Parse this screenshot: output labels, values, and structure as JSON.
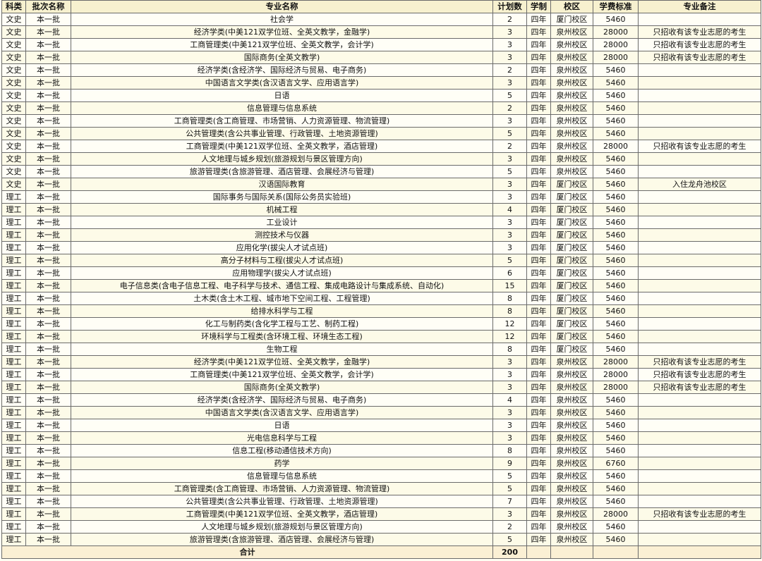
{
  "headers": {
    "category": "科类",
    "batch": "批次名称",
    "major": "专业名称",
    "plan": "计划数",
    "duration": "学制",
    "campus": "校区",
    "tuition": "学费标准",
    "remark": "专业备注"
  },
  "rows": [
    {
      "category": "文史",
      "batch": "本一批",
      "major": "社会学",
      "plan": "2",
      "duration": "四年",
      "campus": "厦门校区",
      "tuition": "5460",
      "remark": ""
    },
    {
      "category": "文史",
      "batch": "本一批",
      "major": "经济学类(中美121双学位班、全英文教学，金融学)",
      "plan": "3",
      "duration": "四年",
      "campus": "泉州校区",
      "tuition": "28000",
      "remark": "只招收有该专业志愿的考生"
    },
    {
      "category": "文史",
      "batch": "本一批",
      "major": "工商管理类(中美121双学位班、全英文教学，会计学)",
      "plan": "3",
      "duration": "四年",
      "campus": "泉州校区",
      "tuition": "28000",
      "remark": "只招收有该专业志愿的考生"
    },
    {
      "category": "文史",
      "batch": "本一批",
      "major": "国际商务(全英文教学)",
      "plan": "3",
      "duration": "四年",
      "campus": "泉州校区",
      "tuition": "28000",
      "remark": "只招收有该专业志愿的考生"
    },
    {
      "category": "文史",
      "batch": "本一批",
      "major": "经济学类(含经济学、国际经济与贸易、电子商务)",
      "plan": "2",
      "duration": "四年",
      "campus": "泉州校区",
      "tuition": "5460",
      "remark": ""
    },
    {
      "category": "文史",
      "batch": "本一批",
      "major": "中国语言文学类(含汉语言文学、应用语言学)",
      "plan": "3",
      "duration": "四年",
      "campus": "泉州校区",
      "tuition": "5460",
      "remark": ""
    },
    {
      "category": "文史",
      "batch": "本一批",
      "major": "日语",
      "plan": "5",
      "duration": "四年",
      "campus": "泉州校区",
      "tuition": "5460",
      "remark": ""
    },
    {
      "category": "文史",
      "batch": "本一批",
      "major": "信息管理与信息系统",
      "plan": "2",
      "duration": "四年",
      "campus": "泉州校区",
      "tuition": "5460",
      "remark": ""
    },
    {
      "category": "文史",
      "batch": "本一批",
      "major": "工商管理类(含工商管理、市场营销、人力资源管理、物流管理)",
      "plan": "3",
      "duration": "四年",
      "campus": "泉州校区",
      "tuition": "5460",
      "remark": ""
    },
    {
      "category": "文史",
      "batch": "本一批",
      "major": "公共管理类(含公共事业管理、行政管理、土地资源管理)",
      "plan": "5",
      "duration": "四年",
      "campus": "泉州校区",
      "tuition": "5460",
      "remark": ""
    },
    {
      "category": "文史",
      "batch": "本一批",
      "major": "工商管理类(中美121双学位班、全英文教学，酒店管理)",
      "plan": "2",
      "duration": "四年",
      "campus": "泉州校区",
      "tuition": "28000",
      "remark": "只招收有该专业志愿的考生"
    },
    {
      "category": "文史",
      "batch": "本一批",
      "major": "人文地理与城乡规划(旅游规划与景区管理方向)",
      "plan": "3",
      "duration": "四年",
      "campus": "泉州校区",
      "tuition": "5460",
      "remark": ""
    },
    {
      "category": "文史",
      "batch": "本一批",
      "major": "旅游管理类(含旅游管理、酒店管理、会展经济与管理)",
      "plan": "5",
      "duration": "四年",
      "campus": "泉州校区",
      "tuition": "5460",
      "remark": ""
    },
    {
      "category": "文史",
      "batch": "本一批",
      "major": "汉语国际教育",
      "plan": "3",
      "duration": "四年",
      "campus": "厦门校区",
      "tuition": "5460",
      "remark": "入住龙舟池校区"
    },
    {
      "category": "理工",
      "batch": "本一批",
      "major": "国际事务与国际关系(国际公务员实验班)",
      "plan": "3",
      "duration": "四年",
      "campus": "厦门校区",
      "tuition": "5460",
      "remark": ""
    },
    {
      "category": "理工",
      "batch": "本一批",
      "major": "机械工程",
      "plan": "4",
      "duration": "四年",
      "campus": "厦门校区",
      "tuition": "5460",
      "remark": ""
    },
    {
      "category": "理工",
      "batch": "本一批",
      "major": "工业设计",
      "plan": "3",
      "duration": "四年",
      "campus": "厦门校区",
      "tuition": "5460",
      "remark": ""
    },
    {
      "category": "理工",
      "batch": "本一批",
      "major": "测控技术与仪器",
      "plan": "3",
      "duration": "四年",
      "campus": "厦门校区",
      "tuition": "5460",
      "remark": ""
    },
    {
      "category": "理工",
      "batch": "本一批",
      "major": "应用化学(拔尖人才试点班)",
      "plan": "3",
      "duration": "四年",
      "campus": "厦门校区",
      "tuition": "5460",
      "remark": ""
    },
    {
      "category": "理工",
      "batch": "本一批",
      "major": "高分子材料与工程(拔尖人才试点班)",
      "plan": "5",
      "duration": "四年",
      "campus": "厦门校区",
      "tuition": "5460",
      "remark": ""
    },
    {
      "category": "理工",
      "batch": "本一批",
      "major": "应用物理学(拔尖人才试点班)",
      "plan": "6",
      "duration": "四年",
      "campus": "厦门校区",
      "tuition": "5460",
      "remark": ""
    },
    {
      "category": "理工",
      "batch": "本一批",
      "major": "电子信息类(含电子信息工程、电子科学与技术、通信工程、集成电路设计与集成系统、自动化)",
      "plan": "15",
      "duration": "四年",
      "campus": "厦门校区",
      "tuition": "5460",
      "remark": ""
    },
    {
      "category": "理工",
      "batch": "本一批",
      "major": "土木类(含土木工程、城市地下空间工程、工程管理)",
      "plan": "8",
      "duration": "四年",
      "campus": "厦门校区",
      "tuition": "5460",
      "remark": ""
    },
    {
      "category": "理工",
      "batch": "本一批",
      "major": "给排水科学与工程",
      "plan": "8",
      "duration": "四年",
      "campus": "厦门校区",
      "tuition": "5460",
      "remark": ""
    },
    {
      "category": "理工",
      "batch": "本一批",
      "major": "化工与制药类(含化学工程与工艺、制药工程)",
      "plan": "12",
      "duration": "四年",
      "campus": "厦门校区",
      "tuition": "5460",
      "remark": ""
    },
    {
      "category": "理工",
      "batch": "本一批",
      "major": "环境科学与工程类(含环境工程、环境生态工程)",
      "plan": "12",
      "duration": "四年",
      "campus": "厦门校区",
      "tuition": "5460",
      "remark": ""
    },
    {
      "category": "理工",
      "batch": "本一批",
      "major": "生物工程",
      "plan": "8",
      "duration": "四年",
      "campus": "厦门校区",
      "tuition": "5460",
      "remark": ""
    },
    {
      "category": "理工",
      "batch": "本一批",
      "major": "经济学类(中美121双学位班、全英文教学，金融学)",
      "plan": "3",
      "duration": "四年",
      "campus": "泉州校区",
      "tuition": "28000",
      "remark": "只招收有该专业志愿的考生"
    },
    {
      "category": "理工",
      "batch": "本一批",
      "major": "工商管理类(中美121双学位班、全英文教学，会计学)",
      "plan": "3",
      "duration": "四年",
      "campus": "泉州校区",
      "tuition": "28000",
      "remark": "只招收有该专业志愿的考生"
    },
    {
      "category": "理工",
      "batch": "本一批",
      "major": "国际商务(全英文教学)",
      "plan": "3",
      "duration": "四年",
      "campus": "泉州校区",
      "tuition": "28000",
      "remark": "只招收有该专业志愿的考生"
    },
    {
      "category": "理工",
      "batch": "本一批",
      "major": "经济学类(含经济学、国际经济与贸易、电子商务)",
      "plan": "4",
      "duration": "四年",
      "campus": "泉州校区",
      "tuition": "5460",
      "remark": ""
    },
    {
      "category": "理工",
      "batch": "本一批",
      "major": "中国语言文学类(含汉语言文学、应用语言学)",
      "plan": "3",
      "duration": "四年",
      "campus": "泉州校区",
      "tuition": "5460",
      "remark": ""
    },
    {
      "category": "理工",
      "batch": "本一批",
      "major": "日语",
      "plan": "3",
      "duration": "四年",
      "campus": "泉州校区",
      "tuition": "5460",
      "remark": ""
    },
    {
      "category": "理工",
      "batch": "本一批",
      "major": "光电信息科学与工程",
      "plan": "3",
      "duration": "四年",
      "campus": "泉州校区",
      "tuition": "5460",
      "remark": ""
    },
    {
      "category": "理工",
      "batch": "本一批",
      "major": "信息工程(移动通信技术方向)",
      "plan": "8",
      "duration": "四年",
      "campus": "泉州校区",
      "tuition": "5460",
      "remark": ""
    },
    {
      "category": "理工",
      "batch": "本一批",
      "major": "药学",
      "plan": "9",
      "duration": "四年",
      "campus": "泉州校区",
      "tuition": "6760",
      "remark": ""
    },
    {
      "category": "理工",
      "batch": "本一批",
      "major": "信息管理与信息系统",
      "plan": "5",
      "duration": "四年",
      "campus": "泉州校区",
      "tuition": "5460",
      "remark": ""
    },
    {
      "category": "理工",
      "batch": "本一批",
      "major": "工商管理类(含工商管理、市场营销、人力资源管理、物流管理)",
      "plan": "5",
      "duration": "四年",
      "campus": "泉州校区",
      "tuition": "5460",
      "remark": ""
    },
    {
      "category": "理工",
      "batch": "本一批",
      "major": "公共管理类(含公共事业管理、行政管理、土地资源管理)",
      "plan": "7",
      "duration": "四年",
      "campus": "泉州校区",
      "tuition": "5460",
      "remark": ""
    },
    {
      "category": "理工",
      "batch": "本一批",
      "major": "工商管理类(中美121双学位班、全英文教学，酒店管理)",
      "plan": "3",
      "duration": "四年",
      "campus": "泉州校区",
      "tuition": "28000",
      "remark": "只招收有该专业志愿的考生"
    },
    {
      "category": "理工",
      "batch": "本一批",
      "major": "人文地理与城乡规划(旅游规划与景区管理方向)",
      "plan": "2",
      "duration": "四年",
      "campus": "泉州校区",
      "tuition": "5460",
      "remark": ""
    },
    {
      "category": "理工",
      "batch": "本一批",
      "major": "旅游管理类(含旅游管理、酒店管理、会展经济与管理)",
      "plan": "5",
      "duration": "四年",
      "campus": "泉州校区",
      "tuition": "5460",
      "remark": ""
    }
  ],
  "footer": {
    "label": "合计",
    "total": "200"
  }
}
